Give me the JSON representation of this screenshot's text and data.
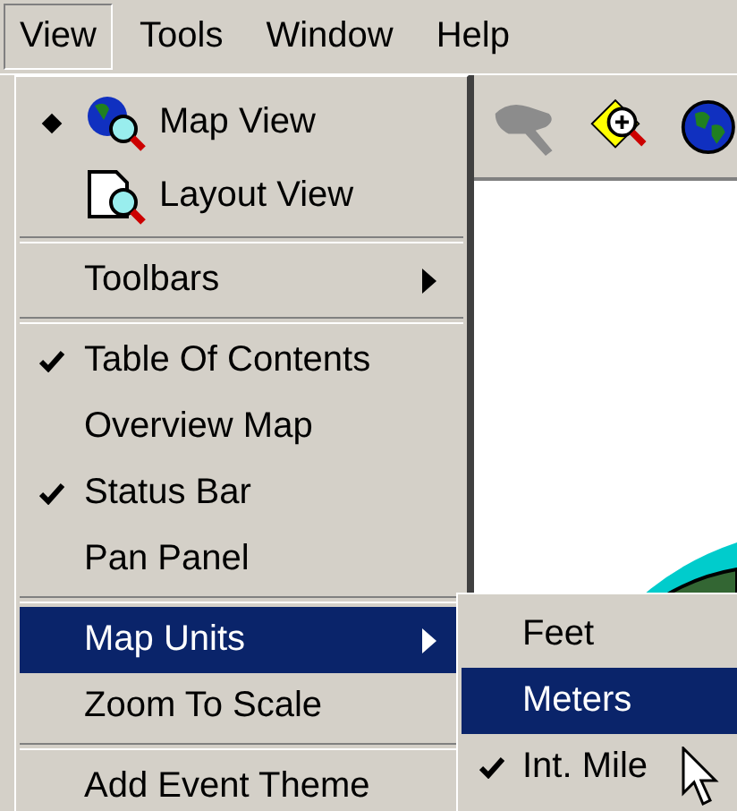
{
  "menubar": [
    {
      "label": "View",
      "selected": true
    },
    {
      "label": "Tools",
      "selected": false
    },
    {
      "label": "Window",
      "selected": false
    },
    {
      "label": "Help",
      "selected": false
    }
  ],
  "view_menu": [
    {
      "kind": "globe_item",
      "label": "Map View",
      "selected": true,
      "checked": false,
      "highlighted": false,
      "has_submenu": false
    },
    {
      "kind": "page_item",
      "label": "Layout View",
      "selected": false,
      "checked": false,
      "highlighted": false,
      "has_submenu": false
    },
    {
      "kind": "separator"
    },
    {
      "kind": "item",
      "label": "Toolbars",
      "selected": false,
      "checked": false,
      "highlighted": false,
      "has_submenu": true
    },
    {
      "kind": "separator"
    },
    {
      "kind": "item",
      "label": "Table Of Contents",
      "selected": false,
      "checked": true,
      "highlighted": false,
      "has_submenu": false
    },
    {
      "kind": "item",
      "label": "Overview Map",
      "selected": false,
      "checked": false,
      "highlighted": false,
      "has_submenu": false
    },
    {
      "kind": "item",
      "label": "Status Bar",
      "selected": false,
      "checked": true,
      "highlighted": false,
      "has_submenu": false
    },
    {
      "kind": "item",
      "label": "Pan Panel",
      "selected": false,
      "checked": false,
      "highlighted": false,
      "has_submenu": false
    },
    {
      "kind": "separator"
    },
    {
      "kind": "item",
      "label": "Map Units",
      "selected": false,
      "checked": false,
      "highlighted": true,
      "has_submenu": true
    },
    {
      "kind": "item",
      "label": "Zoom To Scale",
      "selected": false,
      "checked": false,
      "highlighted": false,
      "has_submenu": false
    },
    {
      "kind": "separator"
    },
    {
      "kind": "item",
      "label": "Add Event Theme",
      "selected": false,
      "checked": false,
      "highlighted": false,
      "has_submenu": false
    }
  ],
  "map_units_menu": [
    {
      "label": "Feet",
      "checked": false,
      "highlighted": false
    },
    {
      "label": "Meters",
      "checked": false,
      "highlighted": true
    },
    {
      "label": "Int. Mile",
      "checked": true,
      "highlighted": false
    }
  ]
}
